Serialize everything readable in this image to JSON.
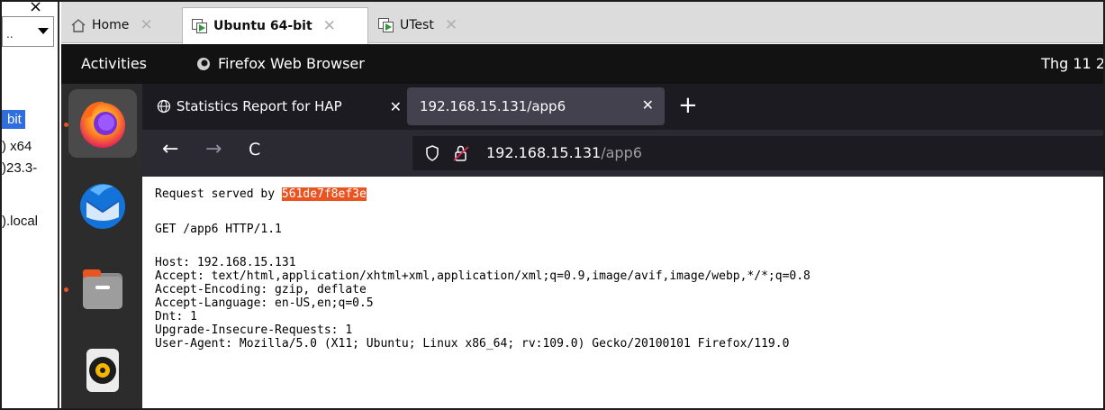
{
  "host_panel": {
    "close_glyph": "×",
    "combo_text": "..",
    "items": [
      "bit",
      ") x64",
      ")23.3-",
      ").local"
    ]
  },
  "vm_tabs": [
    {
      "label": "Home",
      "close": "✕"
    },
    {
      "label": "Ubuntu 64-bit",
      "close": "✕"
    },
    {
      "label": "UTest",
      "close": "✕"
    }
  ],
  "gnome": {
    "activities": "Activities",
    "app_name": "Firefox Web Browser",
    "clock": "Thg 11 2"
  },
  "dock": {
    "items": [
      "firefox-icon",
      "thunderbird-icon",
      "files-icon",
      "rhythmbox-icon"
    ]
  },
  "firefox": {
    "tabs": [
      {
        "title": "Statistics Report for HAP",
        "close": "✕",
        "icon": "globe-icon"
      },
      {
        "title": "192.168.15.131/app6",
        "close": "✕"
      }
    ],
    "new_tab": "+",
    "nav": {
      "back": "←",
      "forward": "→",
      "reload": "C"
    },
    "url": {
      "host": "192.168.15.131",
      "path": "/app6"
    }
  },
  "page": {
    "served_prefix": "Request served by ",
    "served_id": "561de7f8ef3e",
    "request_line": "GET /app6 HTTP/1.1",
    "headers": [
      "Host: 192.168.15.131",
      "Accept: text/html,application/xhtml+xml,application/xml;q=0.9,image/avif,image/webp,*/*;q=0.8",
      "Accept-Encoding: gzip, deflate",
      "Accept-Language: en-US,en;q=0.5",
      "Dnt: 1",
      "Upgrade-Insecure-Requests: 1",
      "User-Agent: Mozilla/5.0 (X11; Ubuntu; Linux x86_64; rv:109.0) Gecko/20100101 Firefox/119.0"
    ]
  },
  "colors": {
    "ubuntu_orange": "#e95420",
    "gnome_bar": "#121212",
    "dock_bg": "#2c2c2c",
    "ff_tabbar": "#1c1b22",
    "ff_nav": "#2b2a33",
    "host_selection": "#2f6ede"
  }
}
